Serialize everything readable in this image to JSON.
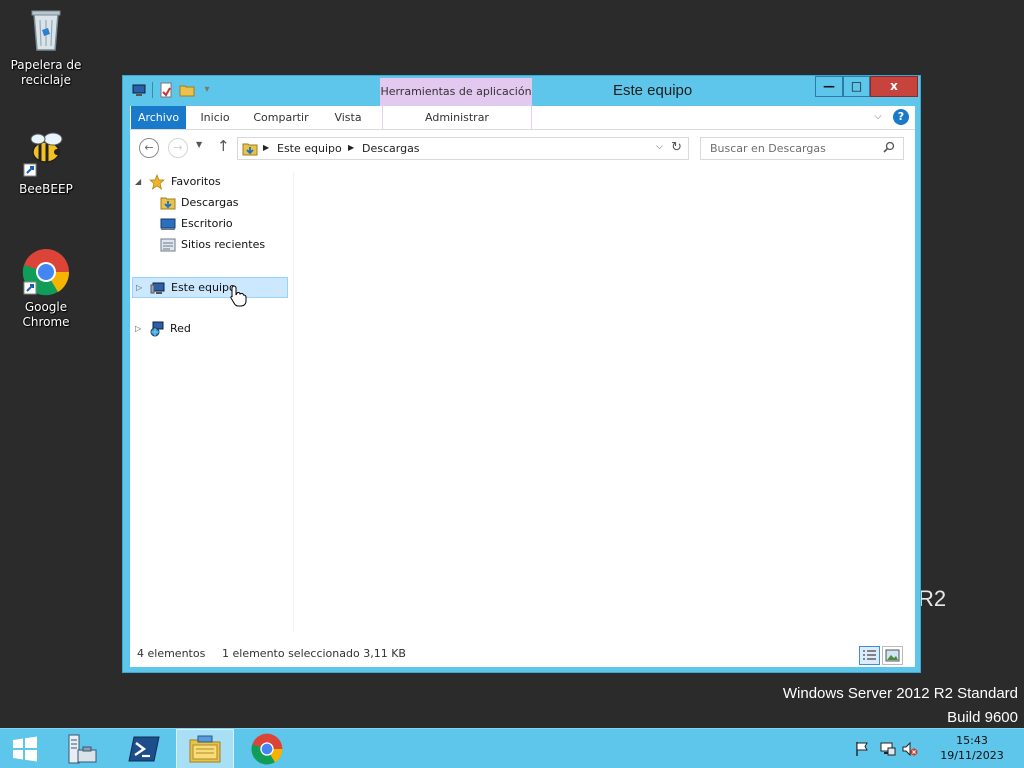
{
  "desktop": {
    "icons": [
      {
        "label": "Papelera de reciclaje"
      },
      {
        "label": "BeeBEEP"
      },
      {
        "label": "Google Chrome"
      }
    ],
    "watermark": {
      "line1": "Windows Server 2012 R2 Standard",
      "line2": "Build 9600",
      "fragment": "R2"
    }
  },
  "window": {
    "title": "Este equipo",
    "context_tab_group": "Herramientas de aplicación",
    "buttons": {
      "minimize": "—",
      "maximize": "□",
      "close": "x"
    },
    "ribbon_tabs": {
      "file": "Archivo",
      "home": "Inicio",
      "share": "Compartir",
      "view": "Vista",
      "manage": "Administrar"
    },
    "help_label": "?"
  },
  "address": {
    "crumbs": [
      "Este equipo",
      "Descargas"
    ]
  },
  "search": {
    "placeholder": "Buscar en Descargas"
  },
  "navpane": {
    "favorites": "Favoritos",
    "downloads": "Descargas",
    "desktop": "Escritorio",
    "recent": "Sitios recientes",
    "this_pc": "Este equipo",
    "network": "Red"
  },
  "status": {
    "count": "4 elementos",
    "selection": "1 elemento seleccionado  3,11 KB"
  },
  "taskbar": {
    "clock_time": "15:43",
    "clock_date": "19/11/2023"
  },
  "colors": {
    "window_frame": "#5ec6ea",
    "file_tab": "#1979ca",
    "context_tab": "#e3c8ef",
    "close_button": "#c7443e",
    "selection": "#cce8ff"
  }
}
